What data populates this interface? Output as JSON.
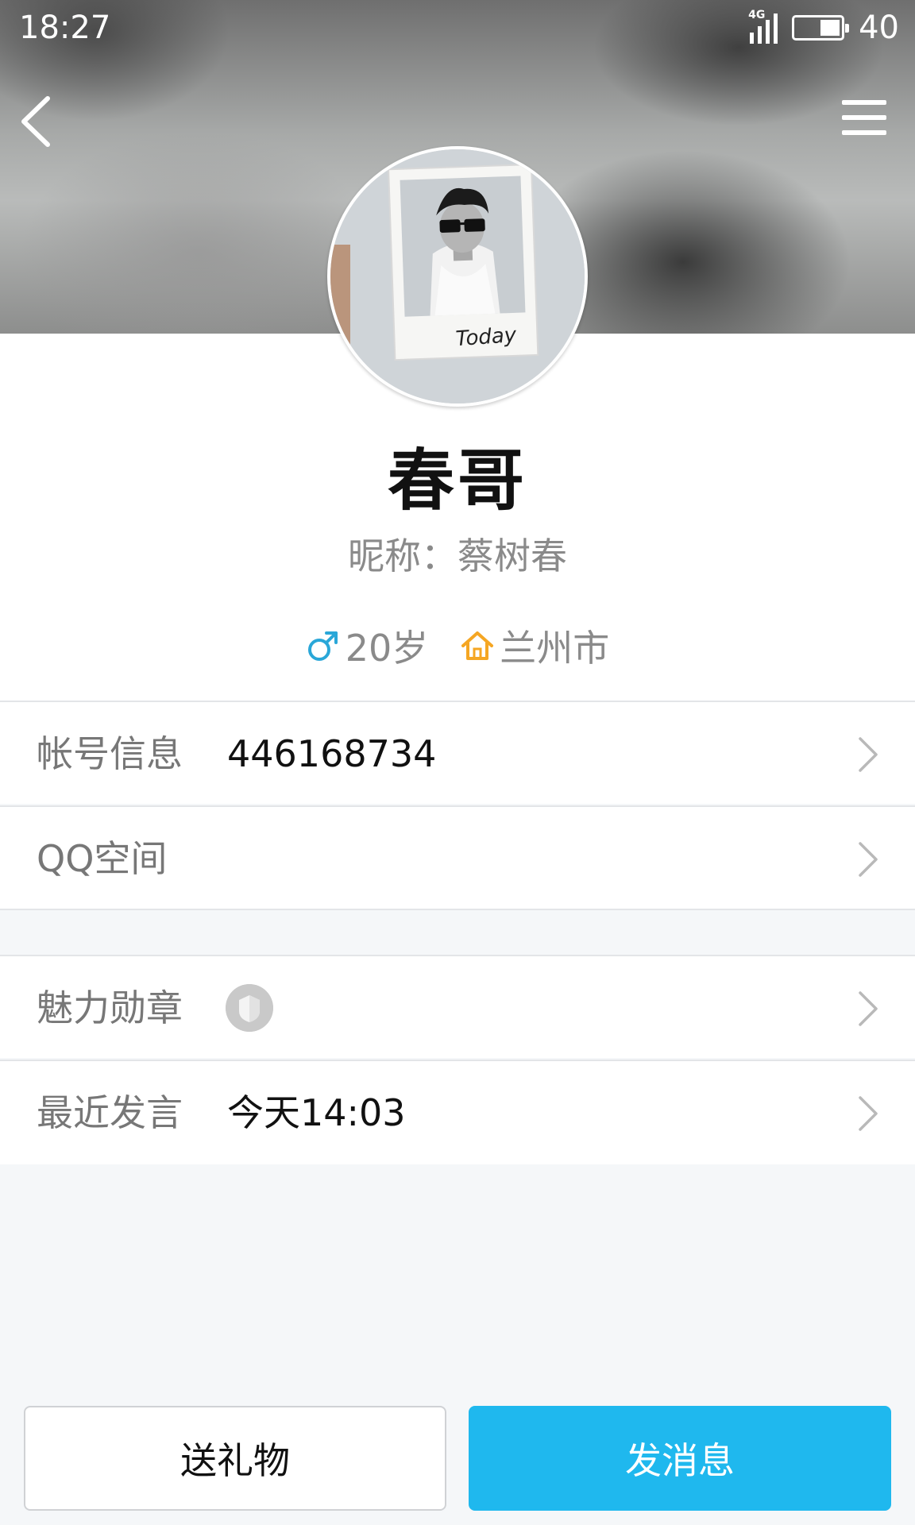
{
  "status_bar": {
    "time": "18:27",
    "network": "4G",
    "battery": "40"
  },
  "header": {
    "back_icon": "chevron-left-icon",
    "menu_icon": "hamburger-menu-icon"
  },
  "profile": {
    "avatar_caption": "Today",
    "name": "春哥",
    "nickname": "昵称：蔡树春",
    "age": "20岁",
    "city": "兰州市",
    "gender_icon_color": "#2aa7d8",
    "home_icon_color": "#f5a623"
  },
  "rows": {
    "account": {
      "label": "帐号信息",
      "value": "446168734"
    },
    "qzone": {
      "label": "QQ空间"
    },
    "charm": {
      "label": "魅力勋章"
    },
    "recent": {
      "label": "最近发言",
      "value": "今天14:03"
    }
  },
  "buttons": {
    "gift": "送礼物",
    "message": "发消息"
  },
  "colors": {
    "accent": "#1fb8ee",
    "background": "#f5f7f9"
  }
}
